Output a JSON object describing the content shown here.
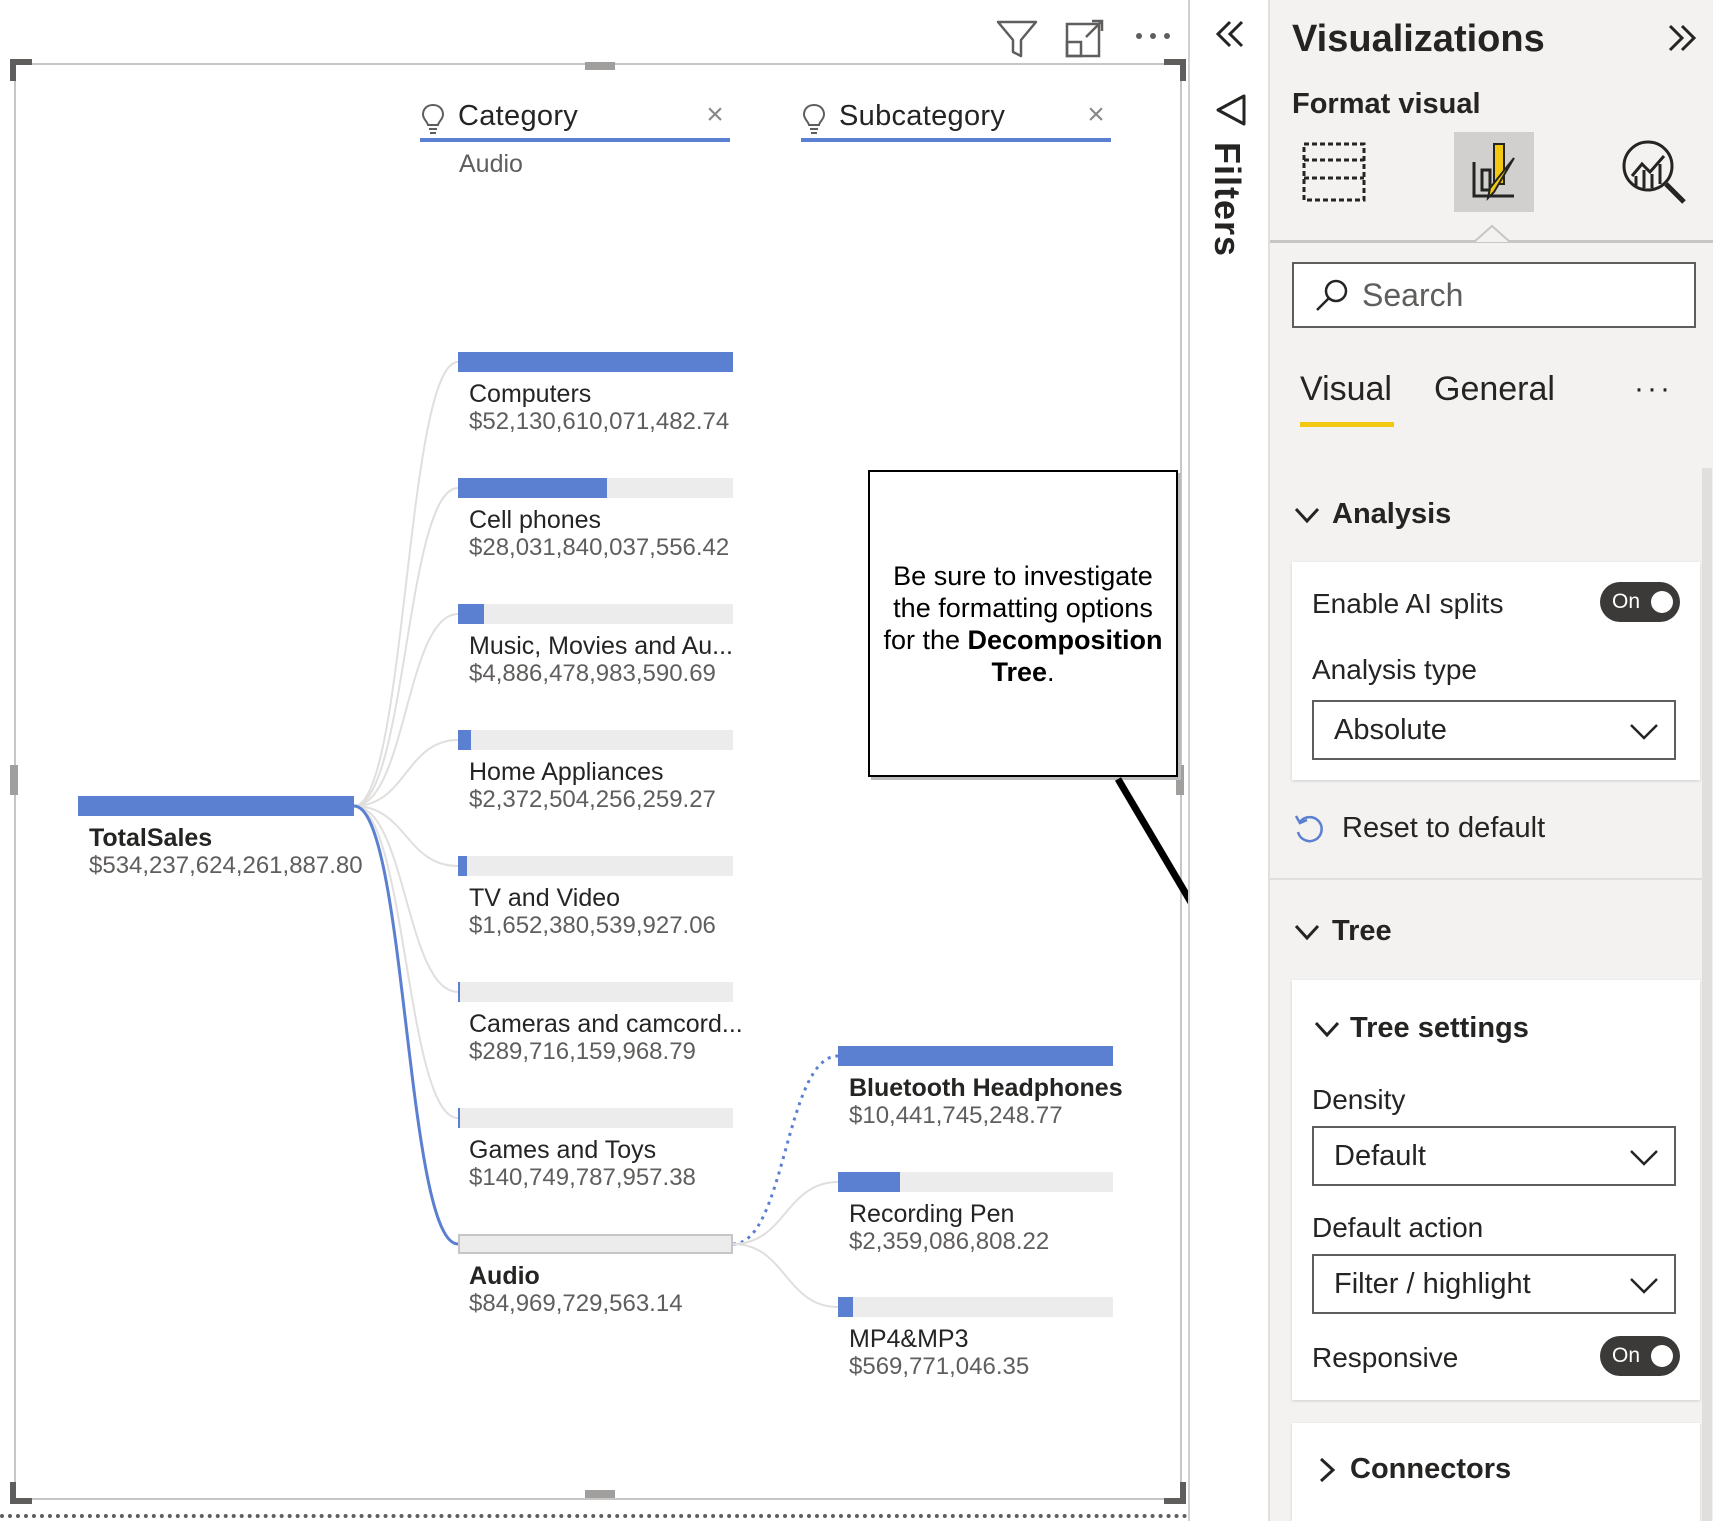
{
  "visual_header": {
    "filter_icon": "filter-icon",
    "focus_icon": "focus-mode-icon",
    "more_icon": "more-options-icon"
  },
  "levels": [
    {
      "label": "Category",
      "selected": "Audio"
    },
    {
      "label": "Subcategory",
      "selected": ""
    }
  ],
  "root": {
    "name": "TotalSales",
    "value": "$534,237,624,261,887.80",
    "fraction": 1.0
  },
  "categories": [
    {
      "name": "Computers",
      "value": "$52,130,610,071,482.74",
      "fraction": 1.0
    },
    {
      "name": "Cell phones",
      "value": "$28,031,840,037,556.42",
      "fraction": 0.54
    },
    {
      "name": "Music, Movies and Au...",
      "value": "$4,886,478,983,590.69",
      "fraction": 0.094
    },
    {
      "name": "Home Appliances",
      "value": "$2,372,504,256,259.27",
      "fraction": 0.046
    },
    {
      "name": "TV and Video",
      "value": "$1,652,380,539,927.06",
      "fraction": 0.032
    },
    {
      "name": "Cameras and camcord...",
      "value": "$289,716,159,968.79",
      "fraction": 0.0056
    },
    {
      "name": "Games and Toys",
      "value": "$140,749,787,957.38",
      "fraction": 0.0027
    },
    {
      "name": "Audio",
      "value": "$84,969,729,563.14",
      "fraction": 0.0016,
      "selected": true
    }
  ],
  "subcategories": [
    {
      "name": "Bluetooth Headphones",
      "value": "$10,441,745,248.77",
      "fraction": 1.0,
      "bold": true
    },
    {
      "name": "Recording Pen",
      "value": "$2,359,086,808.22",
      "fraction": 0.226
    },
    {
      "name": "MP4&MP3",
      "value": "$569,771,046.35",
      "fraction": 0.055
    }
  ],
  "callout": {
    "text_1": "Be sure to investigate the formatting options for the ",
    "bold": "Decomposition Tree",
    "text_2": "."
  },
  "filters_pane": {
    "label": "Filters",
    "collapse_icon": "double-chevron-left-icon",
    "icon": "filter-funnel-icon"
  },
  "viz_pane": {
    "title": "Visualizations",
    "expand_icon": "double-chevron-right-icon",
    "format_visual_label": "Format visual",
    "tab_icons": [
      "build-visual-icon",
      "format-paintbrush-icon",
      "analytics-magnifier-icon"
    ],
    "search_placeholder": "Search",
    "tabs": {
      "visual": "Visual",
      "general": "General",
      "more": "···"
    },
    "analysis": {
      "title": "Analysis",
      "enable_ai_splits": "Enable AI splits",
      "enable_ai_splits_state": "On",
      "analysis_type_label": "Analysis type",
      "analysis_type_value": "Absolute",
      "reset": "Reset to default"
    },
    "tree": {
      "title": "Tree",
      "tree_settings": "Tree settings",
      "density_label": "Density",
      "density_value": "Default",
      "default_action_label": "Default action",
      "default_action_value": "Filter / highlight",
      "responsive_label": "Responsive",
      "responsive_state": "On"
    },
    "connectors": {
      "title": "Connectors"
    }
  },
  "colors": {
    "bar": "#5b7fd1",
    "track": "#ececec",
    "accent_underline": "#f2c811",
    "pane_bg": "#f3f2f1"
  }
}
